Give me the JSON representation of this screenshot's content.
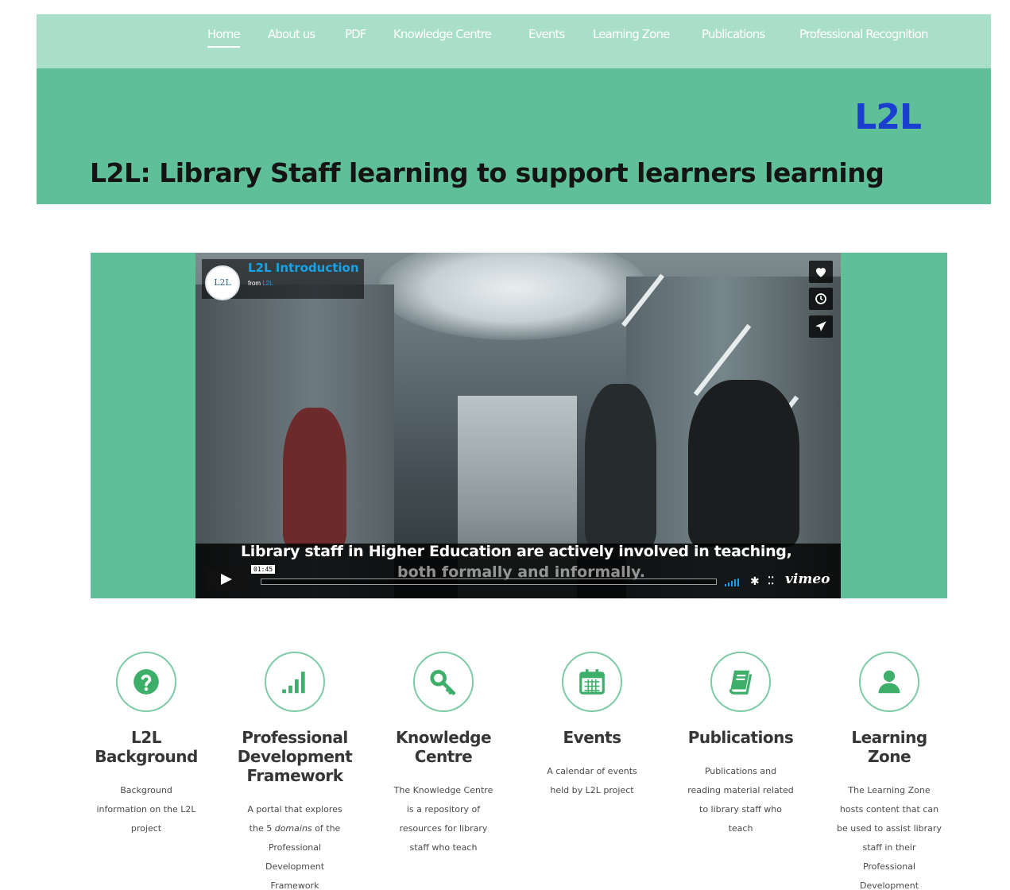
{
  "nav": {
    "items": [
      {
        "label": "Home",
        "active": true
      },
      {
        "label": "About us"
      },
      {
        "label": "PDF"
      },
      {
        "label": "Knowledge Centre"
      },
      {
        "label": "Events"
      },
      {
        "label": "Learning Zone"
      },
      {
        "label": "Publications"
      },
      {
        "label": "Professional Recognition"
      }
    ]
  },
  "hero": {
    "brand": "L2L",
    "title": "L2L: Library Staff learning to support learners learning"
  },
  "video": {
    "logo_text": "L2L",
    "title": "L2L Introduction",
    "from_prefix": "from",
    "from_name": "L2L",
    "caption_line1": "Library staff in Higher Education are actively involved in teaching,",
    "caption_line2": "both formally and informally.",
    "time": "01:45",
    "player_brand": "vimeo",
    "actions": [
      "heart-icon",
      "clock-icon",
      "send-icon"
    ]
  },
  "features": [
    {
      "title_lines": [
        "L2L",
        "Background"
      ],
      "icon": "question-icon",
      "desc_lines": [
        "Background",
        "information on the L2L",
        "project"
      ]
    },
    {
      "title_lines": [
        "Professional",
        "Development",
        "Framework"
      ],
      "icon": "signal-bars-icon",
      "desc_lines": [
        "A portal that explores",
        "the 5 ",
        "domains",
        " of the",
        "Professional",
        "Development",
        "Framework"
      ]
    },
    {
      "title_lines": [
        "Knowledge",
        "Centre"
      ],
      "icon": "key-icon",
      "desc_lines": [
        "The Knowledge Centre",
        "is a repository of",
        "resources for library",
        "staff who teach"
      ]
    },
    {
      "title_lines": [
        "Events"
      ],
      "icon": "calendar-icon",
      "desc_lines": [
        "A calendar of events",
        "held by L2L project"
      ]
    },
    {
      "title_lines": [
        "Publications"
      ],
      "icon": "book-icon",
      "desc_lines": [
        "Publications and",
        "reading material related",
        "to library staff who",
        "teach"
      ]
    },
    {
      "title_lines": [
        "Learning",
        "Zone"
      ],
      "icon": "user-icon",
      "desc_lines": [
        "The Learning Zone",
        "hosts content that can",
        "be used to assist library",
        "staff in their",
        "Professional",
        "Development"
      ]
    }
  ],
  "colors": {
    "accent": "#5ebf99",
    "nav_bg": "#a9dfc9",
    "brand": "#1a3fd0",
    "icon": "#3daf6a"
  }
}
